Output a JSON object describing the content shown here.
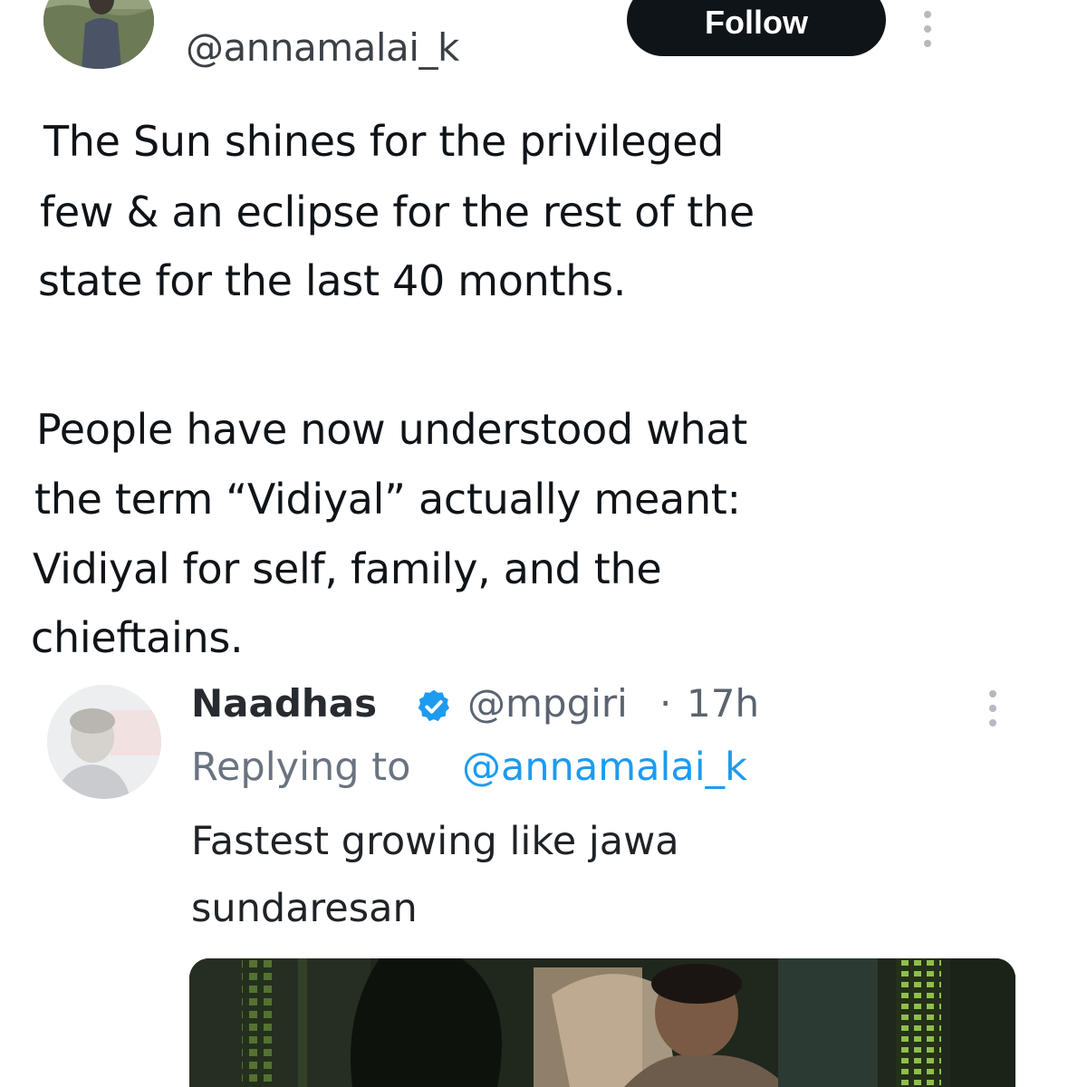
{
  "tweet": {
    "handle": "@annamalai_k",
    "follow_label": "Follow",
    "more_icon": "more-vertical-icon",
    "text_lines": [
      "The Sun shines for the privileged",
      "few & an eclipse for the rest of the",
      "state for the last 40 months.",
      "People have now understood what",
      "the term “Vidiyal” actually meant:",
      "Vidiyal for self, family, and the",
      "chieftains."
    ]
  },
  "reply": {
    "name": "Naadhas",
    "handle": "@mpgiri",
    "separator": "·",
    "time": "17h",
    "replying_prefix": "Replying to",
    "replying_to": "@annamalai_k",
    "text_lines": [
      "Fastest growing like jawa",
      "sundaresan"
    ],
    "verified_icon": "verified-badge-icon",
    "more_icon": "more-vertical-icon"
  },
  "colors": {
    "text": "#0f1419",
    "secondary": "#5b6470",
    "link": "#1d9bf0",
    "verified": "#1d9bf0",
    "button_bg": "#0f1419"
  }
}
